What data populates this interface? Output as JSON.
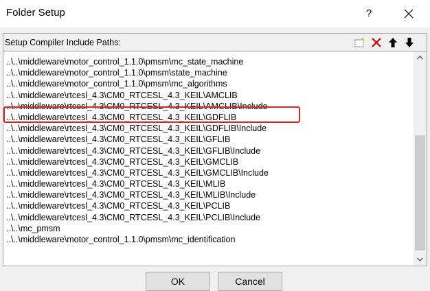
{
  "window": {
    "title": "Folder Setup",
    "help_label": "?"
  },
  "group": {
    "label": "Setup Compiler Include Paths:"
  },
  "paths": [
    "..\\..\\middleware\\motor_control_1.1.0\\pmsm\\mc_state_machine",
    "..\\..\\middleware\\motor_control_1.1.0\\pmsm\\state_machine",
    "..\\..\\middleware\\motor_control_1.1.0\\pmsm\\mc_algorithms",
    "..\\..\\middleware\\rtcesl_4.3\\CM0_RTCESL_4.3_KEIL\\AMCLIB",
    "..\\..\\middleware\\rtcesl_4.3\\CM0_RTCESL_4.3_KEIL\\AMCLIB\\Include",
    "..\\..\\middleware\\rtcesl_4.3\\CM0_RTCESL_4.3_KEIL\\GDFLIB",
    "..\\..\\middleware\\rtcesl_4.3\\CM0_RTCESL_4.3_KEIL\\GDFLIB\\Include",
    "..\\..\\middleware\\rtcesl_4.3\\CM0_RTCESL_4.3_KEIL\\GFLIB",
    "..\\..\\middleware\\rtcesl_4.3\\CM0_RTCESL_4.3_KEIL\\GFLIB\\Include",
    "..\\..\\middleware\\rtcesl_4.3\\CM0_RTCESL_4.3_KEIL\\GMCLIB",
    "..\\..\\middleware\\rtcesl_4.3\\CM0_RTCESL_4.3_KEIL\\GMCLIB\\Include",
    "..\\..\\middleware\\rtcesl_4.3\\CM0_RTCESL_4.3_KEIL\\MLIB",
    "..\\..\\middleware\\rtcesl_4.3\\CM0_RTCESL_4.3_KEIL\\MLIB\\Include",
    "..\\..\\middleware\\rtcesl_4.3\\CM0_RTCESL_4.3_KEIL\\PCLIB",
    "..\\..\\middleware\\rtcesl_4.3\\CM0_RTCESL_4.3_KEIL\\PCLIB\\Include",
    "..\\..\\mc_pmsm",
    "..\\..\\middleware\\motor_control_1.1.0\\pmsm\\mc_identification"
  ],
  "highlighted_path_index": 5,
  "highlight_color": "#e8231f",
  "toolbar_icons": [
    "new-folder-icon",
    "delete-icon",
    "move-up-icon",
    "move-down-icon"
  ],
  "buttons": {
    "ok": "OK",
    "cancel": "Cancel"
  }
}
